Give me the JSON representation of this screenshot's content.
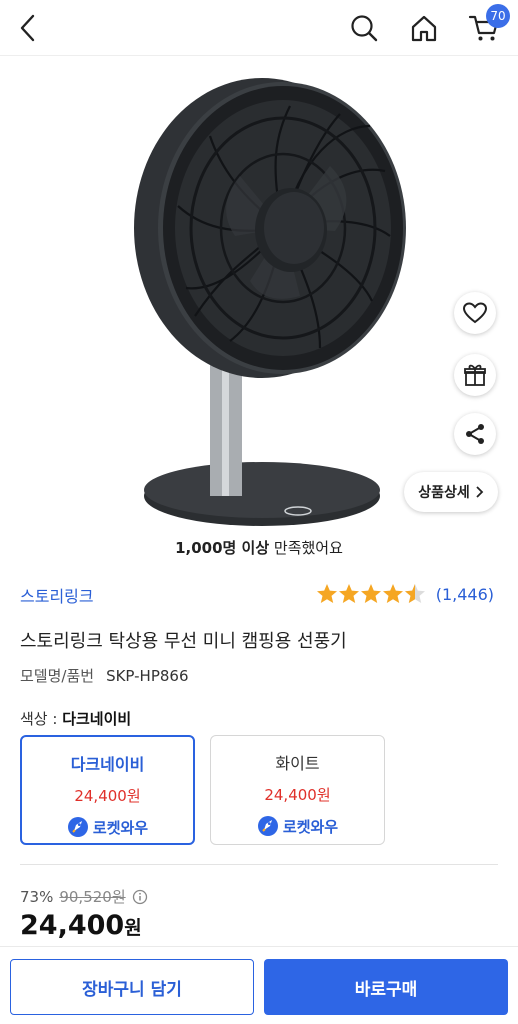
{
  "header": {
    "cart_count": "70",
    "back_icon": "back-arrow-icon",
    "search_icon": "search-icon",
    "home_icon": "home-icon",
    "cart_icon": "cart-icon"
  },
  "hero": {
    "detail_button_label": "상품상세",
    "side_actions": [
      "heart-icon",
      "gift-icon",
      "share-icon"
    ]
  },
  "satisfaction": {
    "bold": "1,000명 이상",
    "rest": " 만족했어요"
  },
  "product": {
    "brand": "스토리링크",
    "rating_stars": 4.5,
    "review_count": "(1,446)",
    "title": "스토리링크 탁상용 무선 미니 캠핑용 선풍기",
    "model_label": "모델명/품번",
    "model_value": "SKP-HP866"
  },
  "color": {
    "label": "색상 : ",
    "selected": "다크네이비",
    "options": [
      {
        "name": "다크네이비",
        "price": "24,400원",
        "badge": "로켓와우",
        "selected": true
      },
      {
        "name": "화이트",
        "price": "24,400원",
        "badge": "로켓와우",
        "selected": false
      }
    ]
  },
  "pricing": {
    "discount_rate": "73%",
    "original_price": "90,520원",
    "final_price_number": "24,400",
    "final_price_unit": "원"
  },
  "bottom_bar": {
    "cart_button": "장바구니 담기",
    "buy_button": "바로구매"
  },
  "colors": {
    "accent_blue": "#2e66e6",
    "price_red": "#e0302a",
    "star_orange": "#f5a623"
  }
}
